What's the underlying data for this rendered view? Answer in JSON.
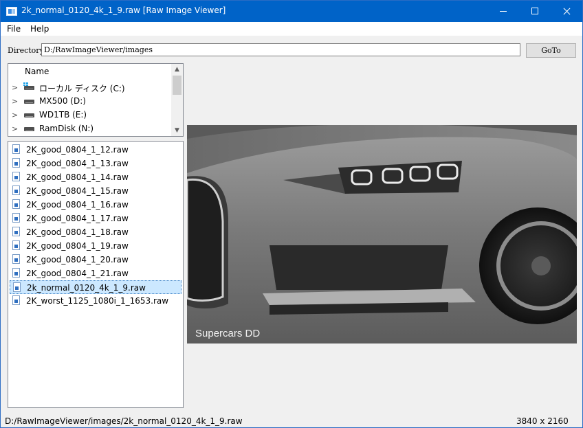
{
  "window": {
    "title": "2k_normal_0120_4k_1_9.raw [Raw Image Viewer]",
    "accent_color": "#0063c8"
  },
  "menu": {
    "file": "File",
    "help": "Help"
  },
  "toolbar": {
    "directory_label": "Directory",
    "directory_value": "D:/RawImageViewer/images",
    "goto_label": "GoTo"
  },
  "tree": {
    "header": "Name",
    "items": [
      {
        "label": "ローカル ディスク (C:)",
        "icon": "windows-drive-icon"
      },
      {
        "label": "MX500 (D:)",
        "icon": "drive-icon"
      },
      {
        "label": "WD1TB (E:)",
        "icon": "drive-icon"
      },
      {
        "label": "RamDisk (N:)",
        "icon": "drive-icon"
      }
    ]
  },
  "files": {
    "items": [
      {
        "name": "2K_good_0804_1_12.raw",
        "selected": false
      },
      {
        "name": "2K_good_0804_1_13.raw",
        "selected": false
      },
      {
        "name": "2K_good_0804_1_14.raw",
        "selected": false
      },
      {
        "name": "2K_good_0804_1_15.raw",
        "selected": false
      },
      {
        "name": "2K_good_0804_1_16.raw",
        "selected": false
      },
      {
        "name": "2K_good_0804_1_17.raw",
        "selected": false
      },
      {
        "name": "2K_good_0804_1_18.raw",
        "selected": false
      },
      {
        "name": "2K_good_0804_1_19.raw",
        "selected": false
      },
      {
        "name": "2K_good_0804_1_20.raw",
        "selected": false
      },
      {
        "name": "2K_good_0804_1_21.raw",
        "selected": false
      },
      {
        "name": "2k_normal_0120_4k_1_9.raw",
        "selected": true
      },
      {
        "name": "2K_worst_1125_1080i_1_1653.raw",
        "selected": false
      }
    ]
  },
  "image": {
    "watermark": "Supercars DD"
  },
  "status": {
    "path": "D:/RawImageViewer/images/2k_normal_0120_4k_1_9.raw",
    "resolution": "3840 x 2160"
  }
}
